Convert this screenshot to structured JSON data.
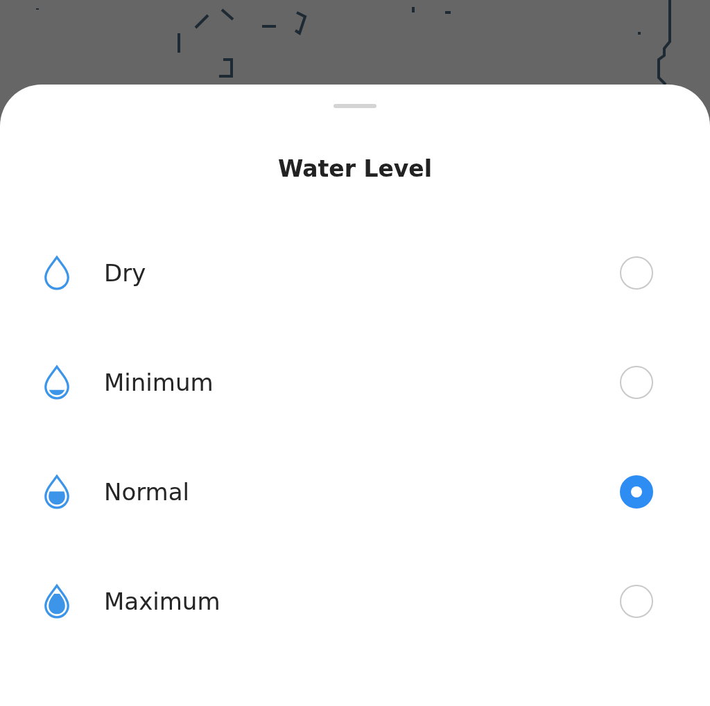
{
  "sheet": {
    "title": "Water Level",
    "options": [
      {
        "label": "Dry",
        "kind": "empty",
        "selected": false
      },
      {
        "label": "Minimum",
        "kind": "low",
        "selected": false
      },
      {
        "label": "Normal",
        "kind": "half",
        "selected": true
      },
      {
        "label": "Maximum",
        "kind": "full",
        "selected": false
      }
    ]
  }
}
